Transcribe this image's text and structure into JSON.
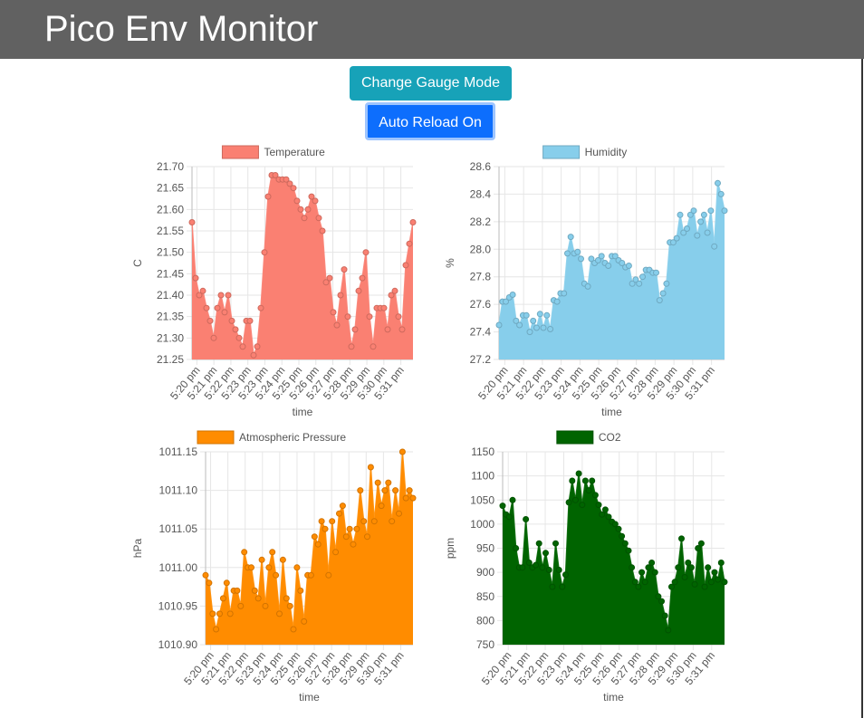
{
  "header": {
    "title": "Pico Env Monitor"
  },
  "buttons": {
    "gauge_mode": "Change Gauge Mode",
    "auto_reload": "Auto Reload On"
  },
  "colors": {
    "header_bg": "#616161",
    "gauge_button": "#17a2b8",
    "reload_button": "#0d6efd"
  },
  "chart_data": [
    {
      "type": "area",
      "title": "",
      "legend": "Temperature",
      "legend_position": "top",
      "xlabel": "time",
      "ylabel": "C",
      "color": "#fa8072",
      "grid": true,
      "ylim": [
        21.25,
        21.7
      ],
      "yticks": [
        21.25,
        21.3,
        21.35,
        21.4,
        21.45,
        21.5,
        21.55,
        21.6,
        21.65,
        21.7
      ],
      "ydecimals": 2,
      "x_tick_labels": [
        "5:20 pm",
        "5:21 pm",
        "5:22 pm",
        "5:23 pm",
        "5:23 pm",
        "5:24 pm",
        "5:25 pm",
        "5:26 pm",
        "5:27 pm",
        "5:28 pm",
        "5:29 pm",
        "5:30 pm",
        "5:31 pm"
      ],
      "values": [
        21.57,
        21.44,
        21.4,
        21.41,
        21.37,
        21.34,
        21.3,
        21.37,
        21.4,
        21.36,
        21.4,
        21.34,
        21.32,
        21.3,
        21.28,
        21.34,
        21.34,
        21.26,
        21.28,
        21.37,
        21.5,
        21.63,
        21.68,
        21.68,
        21.67,
        21.67,
        21.67,
        21.66,
        21.65,
        21.62,
        21.6,
        21.58,
        21.6,
        21.63,
        21.62,
        21.58,
        21.55,
        21.43,
        21.44,
        21.36,
        21.33,
        21.4,
        21.46,
        21.35,
        21.28,
        21.32,
        21.41,
        21.44,
        21.5,
        21.35,
        21.28,
        21.37,
        21.37,
        21.37,
        21.32,
        21.4,
        21.41,
        21.35,
        21.32,
        21.47,
        21.52,
        21.57
      ]
    },
    {
      "type": "area",
      "title": "",
      "legend": "Humidity",
      "legend_position": "top",
      "xlabel": "time",
      "ylabel": "%",
      "color": "#87ceeb",
      "grid": true,
      "ylim": [
        27.2,
        28.6
      ],
      "yticks": [
        27.2,
        27.4,
        27.6,
        27.8,
        28.0,
        28.2,
        28.4,
        28.6
      ],
      "ydecimals": 1,
      "x_tick_labels": [
        "5:20 pm",
        "5:21 pm",
        "5:22 pm",
        "5:23 pm",
        "5:24 pm",
        "5:25 pm",
        "5:26 pm",
        "5:27 pm",
        "5:28 pm",
        "5:29 pm",
        "5:30 pm",
        "5:31 pm"
      ],
      "values": [
        27.45,
        27.62,
        27.62,
        27.65,
        27.67,
        27.48,
        27.45,
        27.52,
        27.52,
        27.4,
        27.48,
        27.43,
        27.53,
        27.43,
        27.52,
        27.42,
        27.63,
        27.62,
        27.68,
        27.68,
        27.97,
        28.09,
        27.97,
        27.98,
        27.93,
        27.75,
        27.73,
        27.93,
        27.9,
        27.92,
        27.95,
        27.9,
        27.88,
        27.95,
        27.95,
        27.92,
        27.9,
        27.87,
        27.88,
        27.75,
        27.78,
        27.75,
        27.8,
        27.85,
        27.85,
        27.83,
        27.83,
        27.63,
        27.68,
        27.75,
        28.05,
        28.05,
        28.08,
        28.25,
        28.12,
        28.15,
        28.25,
        28.28,
        28.1,
        28.2,
        28.25,
        28.12,
        28.28,
        28.02,
        28.48,
        28.4,
        28.28
      ]
    },
    {
      "type": "area",
      "title": "",
      "legend": "Atmospheric Pressure",
      "legend_position": "top",
      "xlabel": "time",
      "ylabel": "hPa",
      "color": "#ff8c00",
      "grid": true,
      "ylim": [
        1010.9,
        1011.15
      ],
      "yticks": [
        1010.9,
        1010.95,
        1011.0,
        1011.05,
        1011.1,
        1011.15
      ],
      "ydecimals": 2,
      "x_tick_labels": [
        "5:20 pm",
        "5:21 pm",
        "5:22 pm",
        "5:23 pm",
        "5:24 pm",
        "5:25 pm",
        "5:26 pm",
        "5:27 pm",
        "5:28 pm",
        "5:29 pm",
        "5:30 pm",
        "5:31 pm"
      ],
      "values": [
        1010.99,
        1010.98,
        1010.94,
        1010.92,
        1010.94,
        1010.96,
        1010.98,
        1010.94,
        1010.97,
        1010.97,
        1010.95,
        1011.02,
        1011.0,
        1011.0,
        1010.97,
        1010.96,
        1011.01,
        1010.95,
        1011.0,
        1011.02,
        1010.99,
        1010.94,
        1011.01,
        1010.96,
        1010.95,
        1010.92,
        1011.0,
        1010.97,
        1010.93,
        1010.99,
        1010.99,
        1011.04,
        1011.03,
        1011.06,
        1011.05,
        1010.99,
        1011.06,
        1011.02,
        1011.07,
        1011.08,
        1011.04,
        1011.05,
        1011.03,
        1011.05,
        1011.1,
        1011.06,
        1011.04,
        1011.13,
        1011.06,
        1011.11,
        1011.08,
        1011.1,
        1011.11,
        1011.06,
        1011.1,
        1011.07,
        1011.15,
        1011.09,
        1011.1,
        1011.09
      ]
    },
    {
      "type": "area",
      "title": "",
      "legend": "CO2",
      "legend_position": "top",
      "xlabel": "time",
      "ylabel": "ppm",
      "color": "#006400",
      "grid": true,
      "ylim": [
        750,
        1150
      ],
      "yticks": [
        750,
        800,
        850,
        900,
        950,
        1000,
        1050,
        1100,
        1150
      ],
      "ydecimals": 0,
      "x_tick_labels": [
        "5:20 pm",
        "5:21 pm",
        "5:22 pm",
        "5:23 pm",
        "5:24 pm",
        "5:25 pm",
        "5:26 pm",
        "5:27 pm",
        "5:28 pm",
        "5:29 pm",
        "5:30 pm",
        "5:31 pm"
      ],
      "values": [
        1038,
        1020,
        1015,
        1050,
        950,
        910,
        910,
        1010,
        920,
        910,
        915,
        960,
        910,
        940,
        905,
        870,
        960,
        905,
        870,
        895,
        1045,
        1090,
        1050,
        1105,
        1040,
        1090,
        1070,
        1090,
        1060,
        1040,
        1020,
        1030,
        1015,
        1005,
        1000,
        990,
        975,
        960,
        945,
        910,
        880,
        870,
        900,
        880,
        910,
        920,
        900,
        850,
        840,
        810,
        780,
        870,
        880,
        910,
        970,
        890,
        920,
        910,
        875,
        950,
        960,
        870,
        910,
        880,
        900,
        885,
        920,
        880
      ]
    }
  ]
}
